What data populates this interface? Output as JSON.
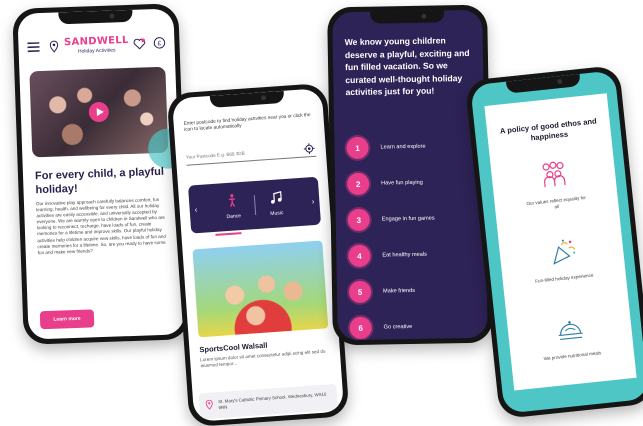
{
  "colors": {
    "accent": "#e83e8c",
    "navy": "#2d2357",
    "teal": "#4ec6c6"
  },
  "phone1": {
    "logo": {
      "main": "SANDWELL",
      "sub": "Holiday Activities"
    },
    "icons": [
      "menu-icon",
      "location-pin-icon",
      "heart-icon",
      "pound-icon"
    ],
    "heading": "For every child, a playful holiday!",
    "body": "Our innovative play approach carefully balances comfort, fun learning, health, and wellbeing for every child. All our holiday activities are easily accessible, and universally accepted by everyone. We are warmly open to children in Sandwell who are looking to reconnect, recharge, have loads of fun, create memories for a lifetime and improve skills. Our playful holiday activities help children acquire new skills, have loads of fun and create memories for a lifetime. So, are you ready to have some fun and make new friends?",
    "button": "Learn more"
  },
  "phone2": {
    "intro": "Enter postcode to find holiday activities near you or click the icon to locate automatically",
    "postcode_placeholder": "Your Postcode E.g. B69 3DB",
    "categories": [
      {
        "label": "Dance",
        "icon": "dance-icon"
      },
      {
        "label": "Music",
        "icon": "music-icon"
      }
    ],
    "card_title": "SportsCool Walsall",
    "card_desc": "Lorem ipsum dolor sit amet consectetur adipi scing elit sed do eiusmod tempor...",
    "address": "St. Mary's Catholic Primary School, Wednesbury, WS10 9RN"
  },
  "phone3": {
    "headline": "We know young children deserve a playful, exciting and fun filled vacation. So we curated well-thought holiday activities just for you!",
    "items": [
      {
        "num": "1",
        "label": "Learn and explore"
      },
      {
        "num": "2",
        "label": "Have fun playing"
      },
      {
        "num": "3",
        "label": "Engage in fun games"
      },
      {
        "num": "4",
        "label": "Eat healthy meals"
      },
      {
        "num": "5",
        "label": "Make friends"
      },
      {
        "num": "6",
        "label": "Go creative"
      }
    ]
  },
  "phone4": {
    "title": "A policy of good ethos and happiness",
    "features": [
      {
        "icon": "people-group-icon",
        "label": "Our values reflect equality for all"
      },
      {
        "icon": "party-popper-icon",
        "label": "Fun-filled holiday experience"
      },
      {
        "icon": "meal-dish-icon",
        "label": "We provide nutritional meals"
      }
    ]
  }
}
